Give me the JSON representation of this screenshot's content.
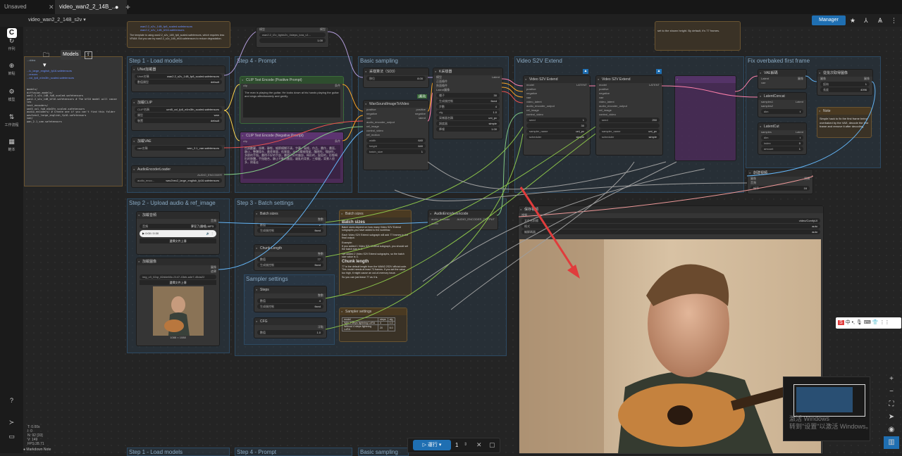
{
  "tabs": [
    {
      "label": "Unsaved Workflow",
      "active": false
    },
    {
      "label": "video_wan2_2_14B_...",
      "active": true
    }
  ],
  "workflow_name": "video_wan2_2_14B_s2v",
  "manager_label": "Manager",
  "sidebar": [
    {
      "icon": "history-icon",
      "label": "作列"
    },
    {
      "icon": "node-library-icon",
      "label": "節點"
    },
    {
      "icon": "models-icon",
      "label": "模型"
    },
    {
      "icon": "workflows-icon",
      "label": "工作流程"
    },
    {
      "icon": "templates-icon",
      "label": "範本"
    }
  ],
  "models_label": "Models",
  "groups": [
    {
      "title": "Step 1 - Load models"
    },
    {
      "title": "Step 4 - Prompt"
    },
    {
      "title": "Basic sampling"
    },
    {
      "title": "Video S2V Extend"
    },
    {
      "title": "Fix overbaked first frame"
    },
    {
      "title": "Step 2 - Upload audio & ref_image"
    },
    {
      "title": "Step 3 - Batch settings"
    },
    {
      "title": "Sampler settings"
    }
  ],
  "nodes": {
    "unet": {
      "title": "UNet加載器",
      "rows": [
        [
          "Unet名稱",
          "wan2.2_s2v_14B_fp8_scaled.safetensors"
        ],
        [
          "數值類型",
          "default"
        ]
      ]
    },
    "clip": {
      "title": "加載CLIP",
      "rows": [
        [
          "CLIP名稱",
          "umt5_xxl_fp8_e4m3fn_scaled.safetensors"
        ],
        [
          "類型",
          "wan"
        ],
        [
          "裝置",
          "default"
        ]
      ]
    },
    "vae": {
      "title": "加載VAE",
      "rows": [
        [
          "vae名稱",
          "wan_2.1_vae.safetensors"
        ]
      ]
    },
    "audioenc": {
      "title": "AudioEncoderLoader",
      "output": "AUDIO_ENCODER",
      "rows": [
        [
          "audio_enco...",
          "wav2vec2_large_english_fp16.safetensors"
        ]
      ]
    },
    "lora": {
      "title": "加載LoRA",
      "rows": [
        [
          "",
          "wan2.2_t2v_lightx2v_4steps_lora_v1..."
        ],
        [
          "",
          "1.00"
        ]
      ]
    },
    "pos": {
      "title": "CLIP Text Encode (Positive Prompt)",
      "text": "The man is playing the guitar. He looks down at his hands playing the guitar and sings affectionately and gently."
    },
    "neg": {
      "title": "CLIP Text Encode (Negative Prompt)",
      "text": "色調艷麗，過曝，靜態，細節模糊不清，字幕，風格，作品，畫作，畫面，靜止，整體發灰，最差質量，低質量，JPEG壓縮殘留，醜陋的，殘缺的，多餘的手指，畫得不好的手部，畫得不好的臉部，畸形的，毀容的，形態畸形的肢體，手指融合，靜止不動的畫面，雜亂的背景，三條腿，背景人很多，倒著走"
    },
    "modelsampling": {
      "title": "采樣算法（SD3）",
      "rows": [
        [
          "移位",
          "8.00"
        ]
      ]
    },
    "wan": {
      "title": "WanSoundImageToVideo",
      "inputs": [
        "positive",
        "negative",
        "vae",
        "audio_encoder_output",
        "ref_image",
        "control_video",
        "ref_motion"
      ],
      "outputs": [
        "positive",
        "negative",
        "latent"
      ],
      "rows": [
        [
          "width",
          "640"
        ],
        [
          "height",
          "640"
        ],
        [
          "batch_size",
          "1"
        ]
      ]
    },
    "ksampler": {
      "title": "K采樣器",
      "rows": [
        [
          "種子",
          "30"
        ],
        [
          "生成後控制",
          "fixed"
        ],
        [
          "步數",
          "4"
        ],
        [
          "cfg",
          "1.0"
        ],
        [
          "采樣器名稱",
          "uni_pc"
        ],
        [
          "調度器",
          "simple"
        ],
        [
          "降噪",
          "1.00"
        ]
      ],
      "badge": "[嘉凌]"
    },
    "s2v1": {
      "title": "Video S2V Extend",
      "inputs": [
        "model",
        "positive",
        "negative",
        "vae",
        "video_latent",
        "audio_encoder_output",
        "ref_image",
        "control_video"
      ],
      "output": "LATENT",
      "rows": [
        [
          "seed",
          "1"
        ],
        [
          "",
          "30"
        ],
        [
          "sampler_name",
          "uni_pc"
        ],
        [
          "scheduler",
          "simple"
        ]
      ]
    },
    "s2v2": {
      "title": "Video S2V Extend",
      "rows": [
        [
          "seed",
          "250"
        ],
        [
          "sampler_name",
          "uni_pc"
        ],
        [
          "scheduler",
          "simple"
        ]
      ]
    },
    "vaedec": {
      "title": "VAE解碼",
      "inputs": [
        "Latent",
        "vae"
      ],
      "output": "圖像"
    },
    "concat": {
      "title": "LatentConcat",
      "inputs": [
        "samples1",
        "samples2"
      ],
      "output": "Latent",
      "rows": [
        [
          "dim",
          "t"
        ]
      ]
    },
    "cut": {
      "title": "LatentCut",
      "inputs": [
        "samples"
      ],
      "output": "Latent",
      "rows": [
        [
          "dim",
          "t"
        ],
        [
          "index",
          "0"
        ],
        [
          "amount",
          "1"
        ]
      ]
    },
    "imgbatch": {
      "title": "從批次取得圖像",
      "inputs": [
        "圖像"
      ],
      "output": "圖像",
      "rows": [
        [
          "起始",
          "1"
        ],
        [
          "長度",
          "4096"
        ]
      ]
    },
    "note1": {
      "title": "Note",
      "text": "Simple hack to fix the first frame being overbaked by the VAE, decode the first frame and remove it after decoding."
    },
    "createvideo": {
      "title": "創建視頻",
      "inputs": [
        "圖像",
        "音頻"
      ],
      "output": "視頻",
      "rows": [
        [
          "幀率",
          "16"
        ]
      ]
    },
    "save": {
      "title": "保存視頻",
      "rows": [
        [
          "文件名前綴",
          "video/ComfyUI"
        ],
        [
          "格式",
          "auto"
        ],
        [
          "編解碼器",
          "auto"
        ]
      ]
    },
    "loadaudio": {
      "title": "加載音頻",
      "output": "音頻",
      "file": "夢見了(翻唱).MP3",
      "player": "0:00 / 0:30",
      "upload": "選擇文件上傳"
    },
    "loadimage": {
      "title": "加載圖像",
      "outputs": [
        "圖像",
        "遮罩"
      ],
      "file": "img_v3_02qr_82d4e60c-2147-43eb-a4e7-45da22",
      "upload": "選擇文件上傳",
      "dims": "1088 × 1088"
    },
    "batchsizes": {
      "title": "Batch sizes",
      "output": "整數",
      "rows": [
        [
          "數值",
          "2"
        ],
        [
          "生成後控制",
          "fixed"
        ]
      ]
    },
    "chunk": {
      "title": "Chunk Length",
      "output": "整數",
      "rows": [
        [
          "數值",
          "77"
        ],
        [
          "生成後控制",
          "fixed"
        ]
      ]
    },
    "steps": {
      "title": "Steps",
      "output": "整數",
      "rows": [
        [
          "數值",
          "4"
        ],
        [
          "生成後控制",
          "fixed"
        ]
      ]
    },
    "cfg": {
      "title": "CFG",
      "output": "浮點",
      "rows": [
        [
          "數值",
          "1.0"
        ]
      ]
    },
    "note2": {
      "title": "Batch sizes",
      "heading": "Batch sizes",
      "p1": "Batch sizes depend on how many Video S2V Extend subgraphs you have added to the workflow.",
      "p2": "Each Video S2V Extend subgraph will add 77 frames to the final output.",
      "p3": "Example:",
      "p4": "If you added 1 Video S2V Extend subgraph, you should set the batch size to 2.",
      "p5": "We added 2 Video S2V Extend subgraphs, so the batch size value is 3.",
      "heading2": "Chunk length",
      "p6": "77 is the default length from the WAN2.2S2V official code. This model needs at least 73 frames. If you set the value too high, it might cause an out-of-memory issue.",
      "p7": "So you can just leave 77 as it is."
    },
    "note3": {
      "title": "Sampler settings",
      "cols": [
        "model",
        "steps",
        "cfg"
      ],
      "rows": [
        [
          "With 4 steps lightning LoRA",
          "4",
          "1.0"
        ],
        [
          "Without 4 steps lightning LoRA",
          "20",
          "6.0"
        ]
      ]
    },
    "audioencenc": {
      "title": "AudioEncoderEncode",
      "inputs": [
        "audio_encoder",
        "audio"
      ],
      "output": "AUDIO_ENCODER_OUTPUT"
    }
  },
  "left_note": {
    "lines": [
      "...ddea",
      "wan2.2_s2v_14B_fp8_scaled.safetensors",
      "wan2.2_s2v_14B_bf16.safetensors",
      "The template is using wan2.2_s2v_14B_fp8_scaled.safetensors, which requires less VRAM. But you can try wan2.2_s2v_14B_bf16.safetensors to reduce degradation."
    ],
    "tree": [
      "...ic_large_english_fp16.safetensors",
      "...ensors",
      "...xxl_fp8_e4m3fn_scaled.safetensors",
      "models/",
      "diffusion_models/",
      "wan2.2_s2v_14B_fp8_scaled.safetensors",
      "wan2.2_s2v_14B_bf16.safetensors  # The bf16 model will cause les",
      "text_encoders/",
      "umt5_xxl_fp8_e4m3fn_scaled.safetensors",
      "audio_encoders/  # Create one if you can't find this folder",
      "wav2vec2_large_english_fp16.safetensors",
      "vae/",
      "wan_2.1_vae.safetensors"
    ]
  },
  "top_note": "set to the shown height. By default, it's 77 frames.",
  "stats": [
    "T: 0.00s",
    "I: 0",
    "N: 92 [33]",
    "V: 149",
    "FPS:28.71"
  ],
  "run": {
    "label": "運行",
    "count": "1"
  },
  "markdown_note": "Markdown Note",
  "watermark": [
    "激活 Windows",
    "转到\"设置\"以激活 Windows。"
  ],
  "ime": "中 •, 🎙 ⌨ 👕 ⋮⋮",
  "colors": {
    "accent": "#1f6fb2",
    "group": "#2d4a63",
    "red_arrow": "#e03c3c",
    "purple_node": "#4b2b57"
  }
}
